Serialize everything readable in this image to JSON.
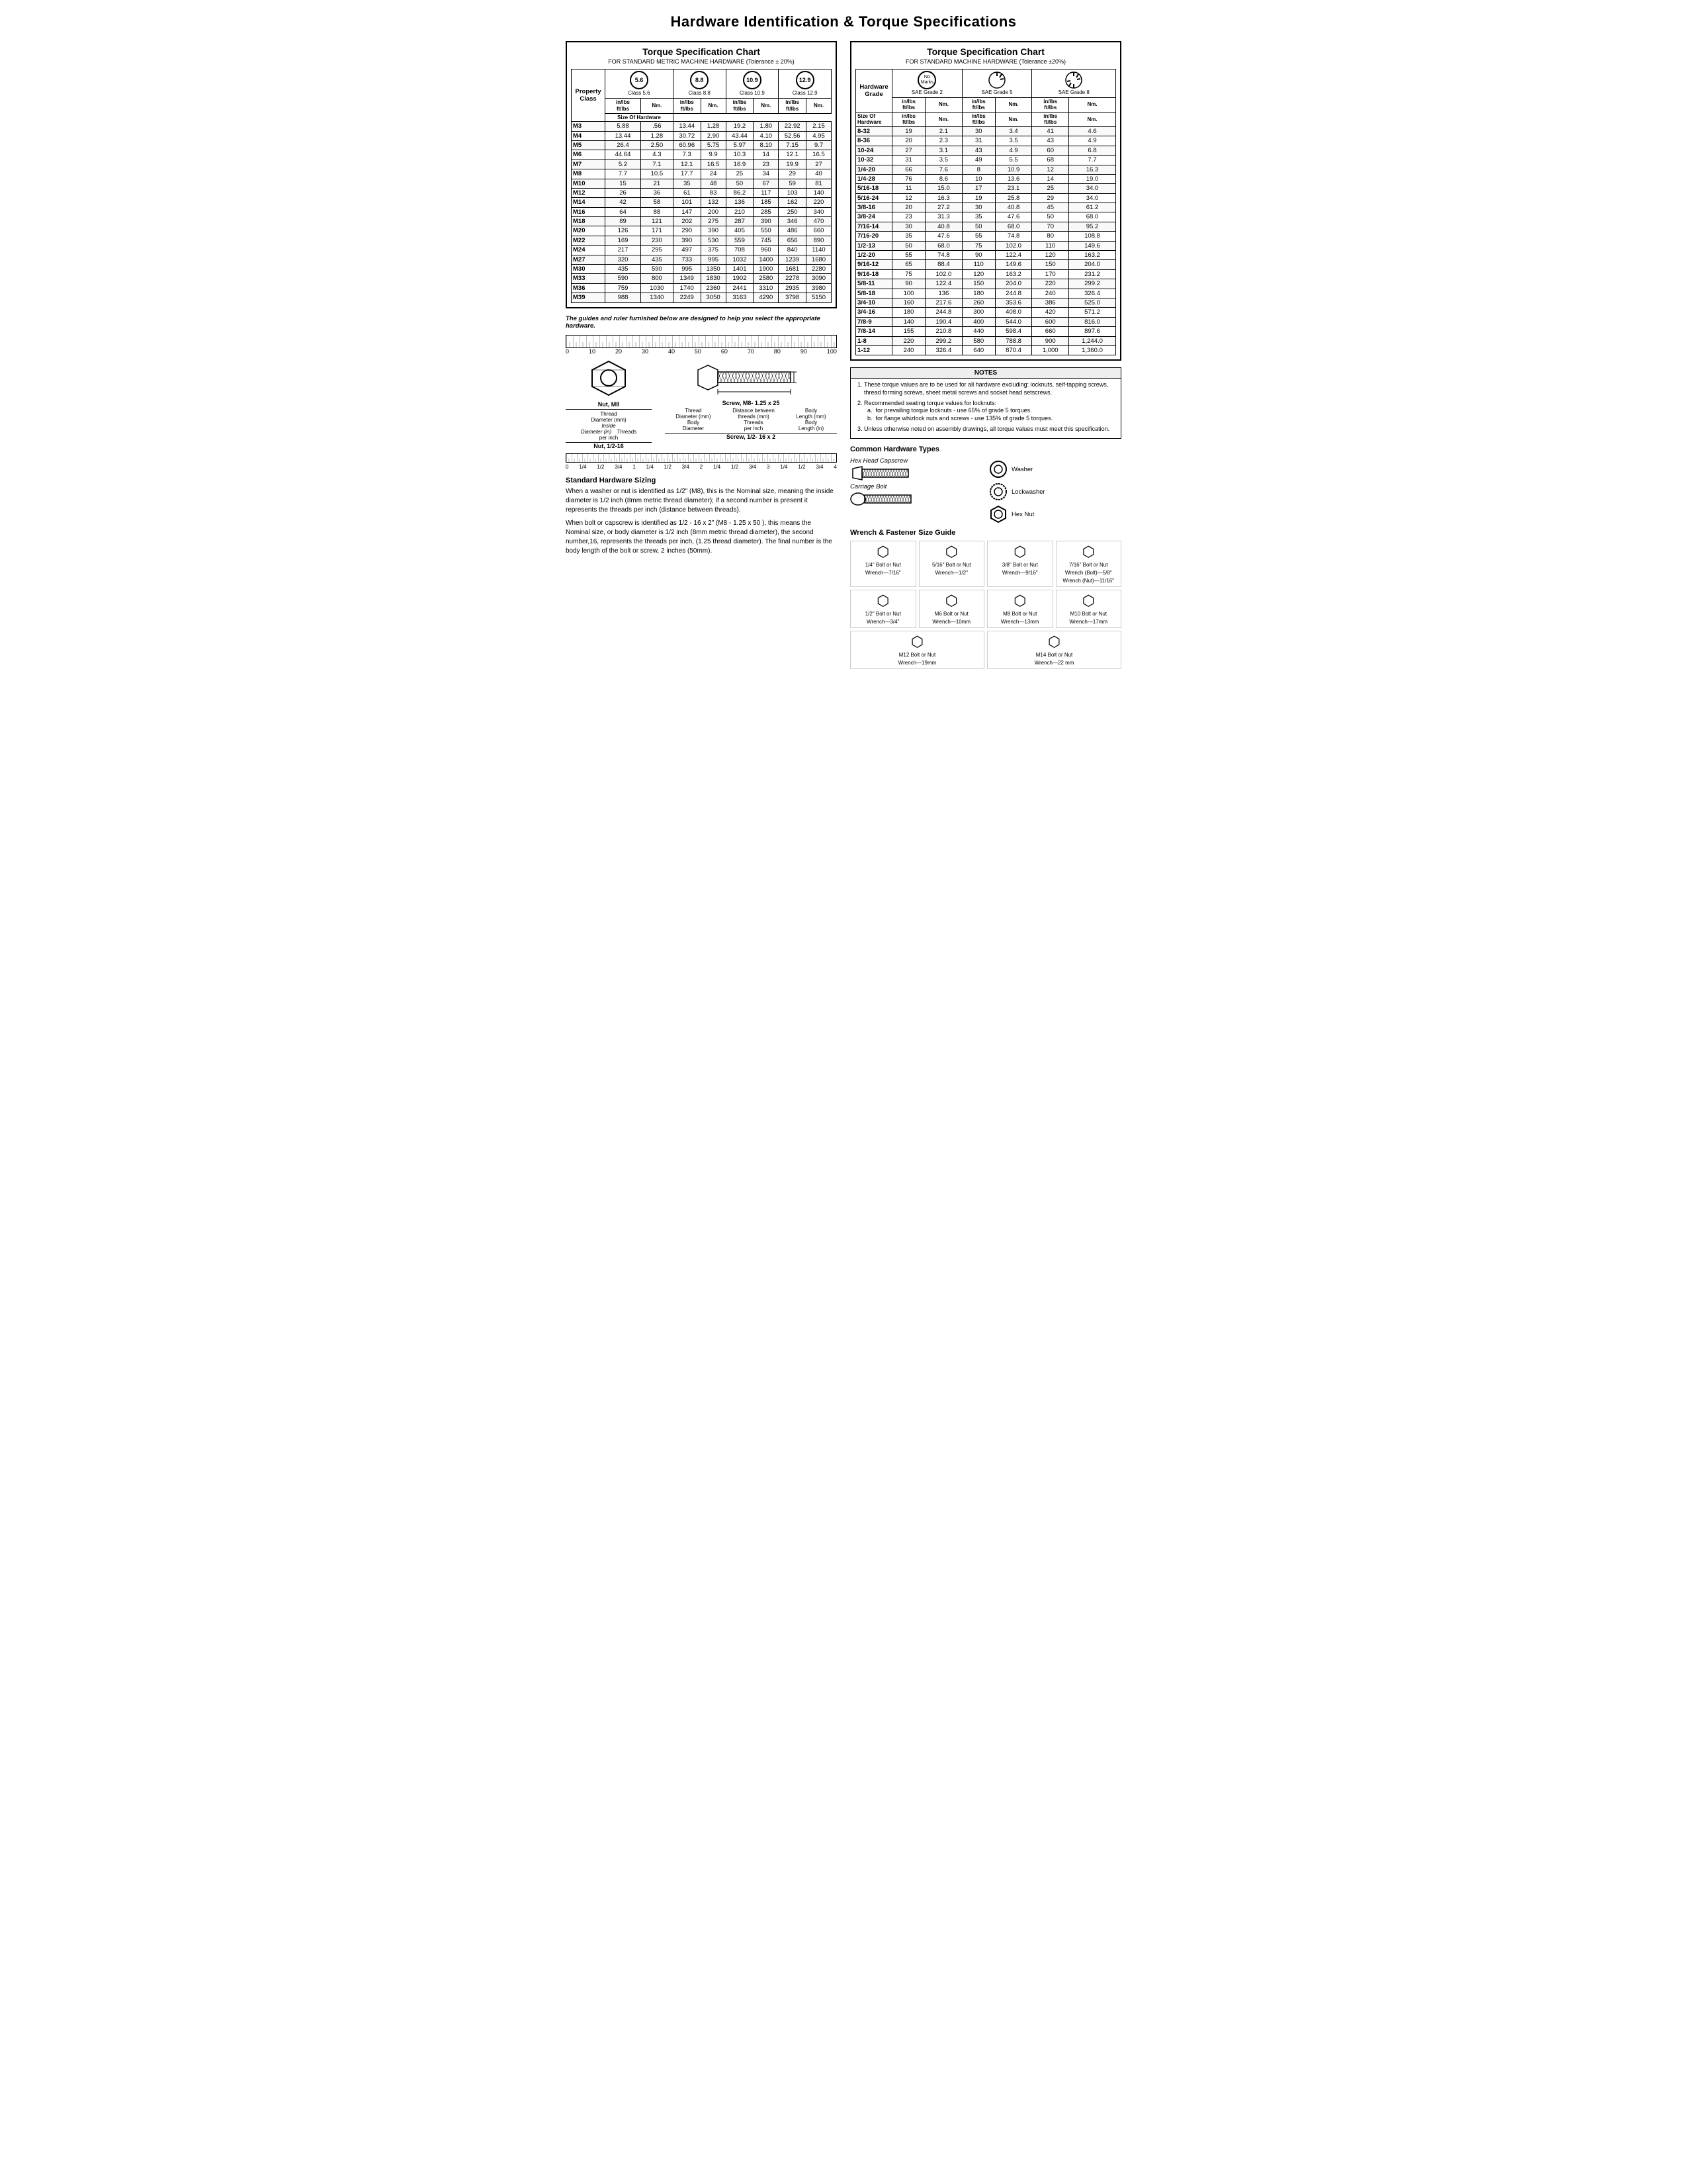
{
  "page": {
    "title": "Hardware Identification  &  Torque Specifications"
  },
  "left_chart": {
    "title": "Torque Specification Chart",
    "subtitle": "FOR STANDARD METRIC MACHINE HARDWARE (Tolerance ± 20%)",
    "property_class_label": "Property Class",
    "classes": [
      {
        "value": "5.6",
        "label": "Class 5.6"
      },
      {
        "value": "8.8",
        "label": "Class 8.8"
      },
      {
        "value": "10.9",
        "label": "Class 10.9"
      },
      {
        "value": "12.9",
        "label": "Class 12.9"
      }
    ],
    "col_headers": [
      "Size Of Hardware",
      "in/lbs ft/lbs",
      "Nm.",
      "in/lbs ft/lbs",
      "Nm.",
      "in/lbs ft/lbs",
      "Nm.",
      "in/lbs ft/lbs",
      "Nm."
    ],
    "rows": [
      [
        "M3",
        "5.88",
        ".56",
        "13.44",
        "1.28",
        "19.2",
        "1.80",
        "22.92",
        "2.15"
      ],
      [
        "M4",
        "13.44",
        "1.28",
        "30.72",
        "2.90",
        "43.44",
        "4.10",
        "52.56",
        "4.95"
      ],
      [
        "M5",
        "26.4",
        "2.50",
        "60.96",
        "5.75",
        "5.97",
        "8.10",
        "7.15",
        "9.7"
      ],
      [
        "M6",
        "44.64",
        "4.3",
        "7.3",
        "9.9",
        "10.3",
        "14",
        "12.1",
        "16.5"
      ],
      [
        "M7",
        "5.2",
        "7.1",
        "12.1",
        "16.5",
        "16.9",
        "23",
        "19.9",
        "27"
      ],
      [
        "M8",
        "7.7",
        "10.5",
        "17.7",
        "24",
        "25",
        "34",
        "29",
        "40"
      ],
      [
        "M10",
        "15",
        "21",
        "35",
        "48",
        "50",
        "67",
        "59",
        "81"
      ],
      [
        "M12",
        "26",
        "36",
        "61",
        "83",
        "86.2",
        "117",
        "103",
        "140"
      ],
      [
        "M14",
        "42",
        "58",
        "101",
        "132",
        "136",
        "185",
        "162",
        "220"
      ],
      [
        "M16",
        "64",
        "88",
        "147",
        "200",
        "210",
        "285",
        "250",
        "340"
      ],
      [
        "M18",
        "89",
        "121",
        "202",
        "275",
        "287",
        "390",
        "346",
        "470"
      ],
      [
        "M20",
        "126",
        "171",
        "290",
        "390",
        "405",
        "550",
        "486",
        "660"
      ],
      [
        "M22",
        "169",
        "230",
        "390",
        "530",
        "559",
        "745",
        "656",
        "890"
      ],
      [
        "M24",
        "217",
        "295",
        "497",
        "375",
        "708",
        "960",
        "840",
        "1140"
      ],
      [
        "M27",
        "320",
        "435",
        "733",
        "995",
        "1032",
        "1400",
        "1239",
        "1680"
      ],
      [
        "M30",
        "435",
        "590",
        "995",
        "1350",
        "1401",
        "1900",
        "1681",
        "2280"
      ],
      [
        "M33",
        "590",
        "800",
        "1349",
        "1830",
        "1902",
        "2580",
        "2278",
        "3090"
      ],
      [
        "M36",
        "759",
        "1030",
        "1740",
        "2360",
        "2441",
        "3310",
        "2935",
        "3980"
      ],
      [
        "M39",
        "988",
        "1340",
        "2249",
        "3050",
        "3163",
        "4290",
        "3798",
        "5150"
      ]
    ],
    "guide_text": "The guides and ruler furnished below are designed to help you select the appropriate hardware.",
    "ruler_numbers": [
      "0",
      "10",
      "20",
      "30",
      "40",
      "50",
      "60",
      "70",
      "80",
      "90",
      "100"
    ],
    "nut_title": "Nut, M8",
    "screw_title": "Screw, M8- 1.25 x 25",
    "thread_diameter_label": "Thread Diameter (mm)",
    "inside_diameter_label": "Inside Diameter (in)",
    "threads_per_inch_label": "Threads per inch",
    "nut_label2": "Nut, 1/2-16",
    "screw_label2": "Screw, 1/2- 16 x 2",
    "thread_dia_mm": "Thread Diameter (mm)",
    "distance_between": "Distance between threads (mm)",
    "body_label": "Body",
    "threads_label": "Threads per inch",
    "body_length_label": "Body Length (mm)",
    "body_length_in": "Body Length (in)",
    "body_diameter_label": "Body Diameter",
    "body_length_arrow": "Body Length",
    "std_hw_title": "Standard Hardware Sizing",
    "std_hw_text1": "When a washer or nut is identified as 1/2\" (M8), this is the Nominal size, meaning the inside diameter is 1/2 inch (8mm metric thread diameter); if a second number is present it represents the threads per inch (distance between threads).",
    "std_hw_text2": "When bolt or capscrew is identified as 1/2 - 16 x 2\" (M8 - 1.25 x 50 ), this means the Nominal size, or body diameter is 1/2 inch (8mm metric thread diameter), the second number,16, represents the threads per inch, (1.25 thread diameter). The final number is the body length of the bolt or screw, 2 inches (50mm)."
  },
  "right_chart": {
    "title": "Torque Specification Chart",
    "subtitle": "FOR STANDARD MACHINE HARDWARE (Tolerance ±20%)",
    "hw_grade_label": "Hardware Grade",
    "grades": [
      {
        "label": "No Marks",
        "sublabel": "SAE Grade 2"
      },
      {
        "label": "SAE Grade 5"
      },
      {
        "label": "SAE Grade 8"
      }
    ],
    "col_headers": [
      "Size Of Hardware",
      "in/lbs ft/lbs",
      "Nm.",
      "in/lbs ft/lbs",
      "Nm.",
      "in/lbs ft/lbs",
      "Nm."
    ],
    "rows": [
      [
        "8-32",
        "19",
        "2.1",
        "30",
        "3.4",
        "41",
        "4.6"
      ],
      [
        "8-36",
        "20",
        "2.3",
        "31",
        "3.5",
        "43",
        "4.9"
      ],
      [
        "10-24",
        "27",
        "3.1",
        "43",
        "4.9",
        "60",
        "6.8"
      ],
      [
        "10-32",
        "31",
        "3.5",
        "49",
        "5.5",
        "68",
        "7.7"
      ],
      [
        "1/4-20",
        "66",
        "7.6",
        "8",
        "10.9",
        "12",
        "16.3"
      ],
      [
        "1/4-28",
        "76",
        "8.6",
        "10",
        "13.6",
        "14",
        "19.0"
      ],
      [
        "5/16-18",
        "11",
        "15.0",
        "17",
        "23.1",
        "25",
        "34.0"
      ],
      [
        "5/16-24",
        "12",
        "16.3",
        "19",
        "25.8",
        "29",
        "34.0"
      ],
      [
        "3/8-16",
        "20",
        "27.2",
        "30",
        "40.8",
        "45",
        "61.2"
      ],
      [
        "3/8-24",
        "23",
        "31.3",
        "35",
        "47.6",
        "50",
        "68.0"
      ],
      [
        "7/16-14",
        "30",
        "40.8",
        "50",
        "68.0",
        "70",
        "95.2"
      ],
      [
        "7/16-20",
        "35",
        "47.6",
        "55",
        "74.8",
        "80",
        "108.8"
      ],
      [
        "1/2-13",
        "50",
        "68.0",
        "75",
        "102.0",
        "110",
        "149.6"
      ],
      [
        "1/2-20",
        "55",
        "74.8",
        "90",
        "122.4",
        "120",
        "163.2"
      ],
      [
        "9/16-12",
        "65",
        "88.4",
        "110",
        "149.6",
        "150",
        "204.0"
      ],
      [
        "9/16-18",
        "75",
        "102.0",
        "120",
        "163.2",
        "170",
        "231.2"
      ],
      [
        "5/8-11",
        "90",
        "122.4",
        "150",
        "204.0",
        "220",
        "299.2"
      ],
      [
        "5/8-18",
        "100",
        "136",
        "180",
        "244.8",
        "240",
        "326.4"
      ],
      [
        "3/4-10",
        "160",
        "217.6",
        "260",
        "353.6",
        "386",
        "525.0"
      ],
      [
        "3/4-16",
        "180",
        "244.8",
        "300",
        "408.0",
        "420",
        "571.2"
      ],
      [
        "7/8-9",
        "140",
        "190.4",
        "400",
        "544.0",
        "600",
        "816.0"
      ],
      [
        "7/8-14",
        "155",
        "210.8",
        "440",
        "598.4",
        "660",
        "897.6"
      ],
      [
        "1-8",
        "220",
        "299.2",
        "580",
        "788.8",
        "900",
        "1,244.0"
      ],
      [
        "1-12",
        "240",
        "326.4",
        "640",
        "870.4",
        "1,000",
        "1,360.0"
      ]
    ],
    "notes_title": "NOTES",
    "notes": [
      "These torque values are to be used for all hardware excluding: locknuts, self-tapping screws, thread forming screws, sheet metal screws and socket head setscrews.",
      "Recommended seating torque values for locknuts:\n  a.  for prevailing torque locknuts - use 65% of grade 5 torques.\n  b.  for flange whizlock nuts and screws - use 135% of grade 5 torques.",
      "Unless otherwise noted on assembly drawings, all torque values must meet this specification."
    ],
    "common_hw_title": "Common Hardware Types",
    "hex_head_label": "Hex Head Capscrew",
    "carriage_bolt_label": "Carriage Bolt",
    "washer_label": "Washer",
    "lockwasher_label": "Lockwasher",
    "hex_nut_label": "Hex Nut",
    "wrench_guide_title": "Wrench & Fastener Size Guide",
    "wrench_items": [
      {
        "bolt": "1/4\" Bolt or Nut",
        "wrench": "Wrench—7/16\""
      },
      {
        "bolt": "5/16\" Bolt or Nut",
        "wrench": "Wrench—1/2\""
      },
      {
        "bolt": "3/8\" Bolt or Nut",
        "wrench": "Wrench—9/16\""
      },
      {
        "bolt": "7/16\" Bolt or Nut",
        "wrench": "Wrench (Bolt)—5/8\" Wrench (Nut)—11/16\""
      },
      {
        "bolt": "1/2\" Bolt or Nut",
        "wrench": "Wrench—3/4\""
      },
      {
        "bolt": "M6 Bolt or Nut",
        "wrench": "Wrench—10mm"
      },
      {
        "bolt": "M8 Bolt or Nut",
        "wrench": "Wrench—13mm"
      },
      {
        "bolt": "M10 Bolt or Nut",
        "wrench": "Wrench—17mm"
      },
      {
        "bolt": "M12 Bolt or Nut",
        "wrench": "Wrench—19mm"
      },
      {
        "bolt": "M14 Bolt or Nut",
        "wrench": "Wrench—22 mm"
      }
    ]
  }
}
